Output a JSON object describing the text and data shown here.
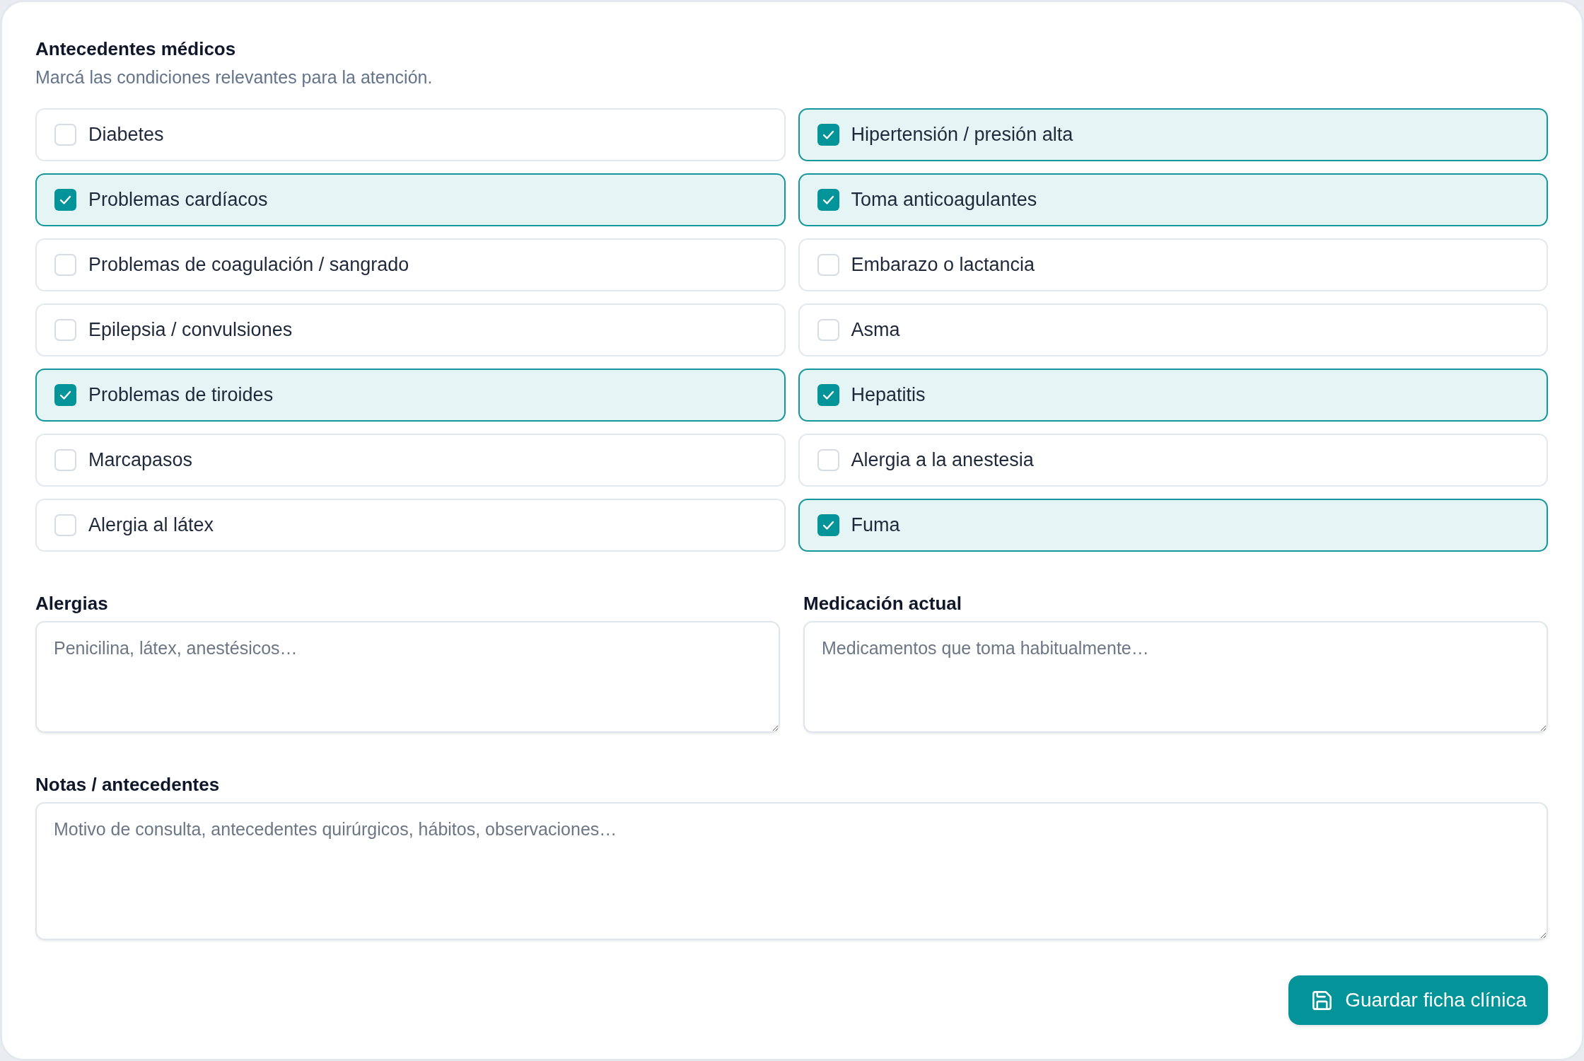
{
  "section": {
    "title": "Antecedentes médicos",
    "subtitle": "Marcá las condiciones relevantes para la atención."
  },
  "conditions": [
    {
      "label": "Diabetes",
      "checked": false
    },
    {
      "label": "Hipertensión / presión alta",
      "checked": true
    },
    {
      "label": "Problemas cardíacos",
      "checked": true
    },
    {
      "label": "Toma anticoagulantes",
      "checked": true
    },
    {
      "label": "Problemas de coagulación / sangrado",
      "checked": false
    },
    {
      "label": "Embarazo o lactancia",
      "checked": false
    },
    {
      "label": "Epilepsia / convulsiones",
      "checked": false
    },
    {
      "label": "Asma",
      "checked": false
    },
    {
      "label": "Problemas de tiroides",
      "checked": true
    },
    {
      "label": "Hepatitis",
      "checked": true
    },
    {
      "label": "Marcapasos",
      "checked": false
    },
    {
      "label": "Alergia a la anestesia",
      "checked": false
    },
    {
      "label": "Alergia al látex",
      "checked": false
    },
    {
      "label": "Fuma",
      "checked": true
    }
  ],
  "fields": [
    {
      "label": "Alergias",
      "placeholder": "Penicilina, látex, anestésicos…"
    },
    {
      "label": "Medicación actual",
      "placeholder": "Medicamentos que toma habitualmente…"
    }
  ],
  "notes": {
    "label": "Notas / antecedentes",
    "placeholder": "Motivo de consulta, antecedentes quirúrgicos, hábitos, observaciones…"
  },
  "save_button": {
    "label": "Guardar ficha clínica"
  }
}
